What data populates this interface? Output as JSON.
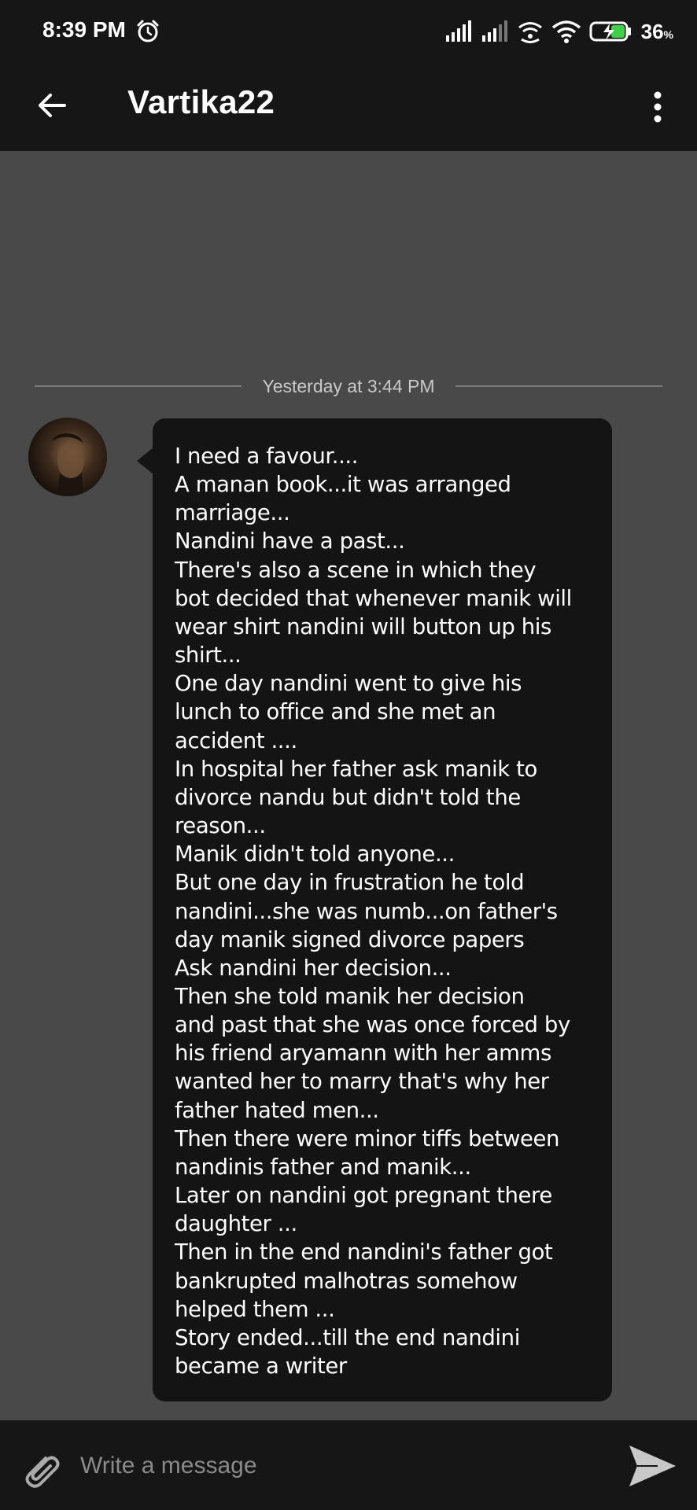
{
  "status_bar": {
    "time": "8:39 PM",
    "battery_percent": "36",
    "battery_unit": "%",
    "icons": [
      "alarm-icon",
      "signal-icon",
      "signal-icon",
      "wifi-calling-icon",
      "wifi-icon",
      "battery-charging-icon"
    ]
  },
  "header": {
    "title": "Vartika22",
    "back_icon": "back-arrow-icon",
    "menu_icon": "more-vert-icon"
  },
  "conversation": {
    "date_divider": "Yesterday at 3:44 PM",
    "messages": [
      {
        "sender_avatar": "avatar",
        "lines": [
          "I need a favour....",
          "A manan book...it was arranged",
          "marriage...",
          "Nandini have a past...",
          "There's also a scene in which they",
          "bot decided that whenever manik will",
          "wear shirt nandini will button up his",
          "shirt...",
          "One day nandini went to give his",
          "lunch to office and she met an",
          "accident ....",
          "In hospital her father ask manik to",
          "divorce nandu but didn't told the",
          "reason...",
          "Manik didn't told anyone...",
          "But one day in frustration he told",
          "nandini...she was numb...on father's",
          "day manik signed divorce papers",
          "Ask nandini her decision...",
          "Then she told manik her decision",
          "and past that she was once forced by",
          "his friend aryamann with her amms",
          "wanted her to marry that's why her",
          "father hated men...",
          "Then there were minor tiffs between",
          "nandinis father and manik...",
          "Later on nandini got pregnant there",
          "daughter ...",
          "Then in the end nandini's father got",
          "bankrupted malhotras somehow",
          "helped them ...",
          "Story ended...till the end nandini",
          "became a writer"
        ]
      }
    ]
  },
  "composer": {
    "placeholder": "Write a message",
    "attach_icon": "paperclip-icon",
    "send_icon": "send-icon"
  },
  "colors": {
    "bar_background": "#161616",
    "chat_background": "#494949",
    "bubble_background": "#141414"
  }
}
